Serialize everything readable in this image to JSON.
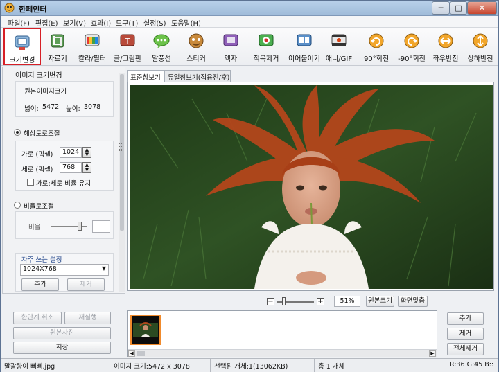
{
  "window": {
    "title": "한페인터",
    "controls": {
      "minimize": "─",
      "maximize": "□",
      "close": "✕"
    }
  },
  "menu": [
    "파일(F)",
    "편집(E)",
    "보기(V)",
    "효과(I)",
    "도구(T)",
    "설정(S)",
    "도움말(H)"
  ],
  "toolbar": [
    {
      "label": "크기변경",
      "icon": "resize-icon",
      "active": true
    },
    {
      "label": "자르기",
      "icon": "crop-icon"
    },
    {
      "label": "칼라/필터",
      "icon": "color-filter-icon"
    },
    {
      "label": "글/그림판",
      "icon": "text-paint-icon"
    },
    {
      "label": "말풍선",
      "icon": "speech-bubble-icon"
    },
    {
      "label": "스티커",
      "icon": "sticker-icon"
    },
    {
      "label": "액자",
      "icon": "frame-icon"
    },
    {
      "label": "적목제거",
      "icon": "red-eye-icon"
    },
    {
      "label": "이어붙이기",
      "icon": "merge-icon"
    },
    {
      "label": "애니/GIF",
      "icon": "gif-icon"
    },
    {
      "label": "90°회전",
      "icon": "rotate-cw-icon"
    },
    {
      "label": "-90°회전",
      "icon": "rotate-ccw-icon"
    },
    {
      "label": "좌우반전",
      "icon": "flip-horizontal-icon"
    },
    {
      "label": "상하반전",
      "icon": "flip-vertical-icon"
    }
  ],
  "left_panel": {
    "title": "이미지 크기변경",
    "original": {
      "title": "원본이미지크기",
      "width_label": "넓이:",
      "width": "5472",
      "height_label": "높이:",
      "height": "3078"
    },
    "resolution": {
      "label": "해상도로조절",
      "selected": true,
      "width_label": "가로 (픽셀)",
      "width": "1024",
      "height_label": "세로 (픽셀)",
      "height": "768",
      "keep_ratio_label": "가로:세로 비율 유지",
      "keep_ratio": false
    },
    "ratio": {
      "label": "비율로조절",
      "selected": false,
      "ratio_label": "비율",
      "slider_value": 0.8
    },
    "presets": {
      "title": "자주 쓰는 설정",
      "selected": "1024X768",
      "add": "추가",
      "remove": "제거"
    },
    "actions": {
      "undo": "한단계 취소",
      "redo": "재실행",
      "original": "원본사진",
      "save": "저장"
    }
  },
  "tabs": [
    "표준창보기",
    "듀얼창보기(적용전/후)"
  ],
  "zoom": {
    "minus": "−",
    "plus": "+",
    "value": "51%",
    "original_size": "원본크기",
    "fit": "화면맞춤",
    "slider_value": 0.2
  },
  "thumb_actions": {
    "add": "추가",
    "remove": "제거",
    "remove_all": "전체제거"
  },
  "status": {
    "file": "말괄량이 삐삐.jpg",
    "size": "이미지 크기:5472 x 3078",
    "selection": "선택된 개체:1(13062KB)",
    "total": "총 1 개체",
    "color": "R:36 G:45 B::"
  },
  "colors": {
    "accent_red": "#d61f26",
    "title_blue": "#1a3f86"
  }
}
